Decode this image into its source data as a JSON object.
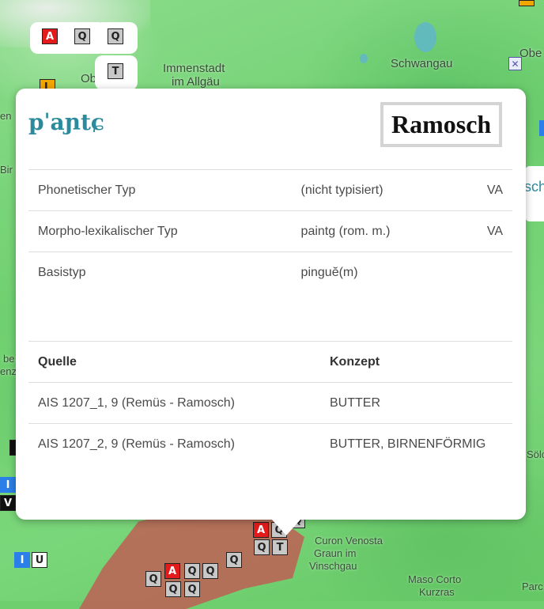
{
  "map": {
    "places": [
      "Immenstadt",
      "im Allgäu",
      "Schwangau",
      "Ober",
      "Obe",
      "Curon Venosta",
      "Graun im",
      "Vinschgau",
      "Maso Corto",
      "Kurzras",
      "Parc",
      "Sölc",
      "Bir",
      "en",
      "be",
      "enz"
    ]
  },
  "markers": {
    "a": "A",
    "q": "Q",
    "t": "T",
    "l": "L",
    "i": "I",
    "u": "U",
    "v": "V",
    "x": "✕"
  },
  "side_panel": {
    "text": "sch"
  },
  "popup": {
    "ipa": "pˈaɲtɕ",
    "location": "Ramosch",
    "types": [
      {
        "label": "Phonetischer Typ",
        "value": "(nicht typisiert)",
        "source": "VA"
      },
      {
        "label": "Morpho-lexikalischer Typ",
        "value": "paintg (rom. m.)",
        "source": "VA"
      },
      {
        "label": "Basistyp",
        "value": "pinguĕ(m)",
        "source": ""
      }
    ],
    "sources_header": {
      "quelle": "Quelle",
      "konzept": "Konzept"
    },
    "sources": [
      {
        "quelle": "AIS 1207_1, 9 (Remüs - Ramosch)",
        "konzept": "BUTTER"
      },
      {
        "quelle": "AIS 1207_2, 9 (Remüs - Ramosch)",
        "konzept": "BUTTER, BIRNENFÖRMIG"
      }
    ]
  }
}
